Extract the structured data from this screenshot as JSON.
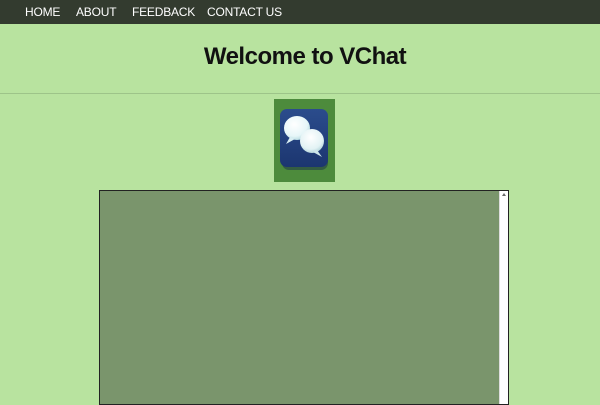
{
  "nav": {
    "items": [
      {
        "label": "HOME"
      },
      {
        "label": "ABOUT"
      },
      {
        "label": "FEEDBACK"
      },
      {
        "label": "CONTACT US"
      }
    ]
  },
  "header": {
    "title": "Welcome to VChat"
  },
  "logo": {
    "icon": "chat-bubbles-icon",
    "bg_color": "#4d8b3c",
    "tile_color": "#21407c"
  },
  "colors": {
    "page_bg": "#b8e39f",
    "nav_bg": "#333b2f",
    "chat_bg": "#7a956c"
  }
}
